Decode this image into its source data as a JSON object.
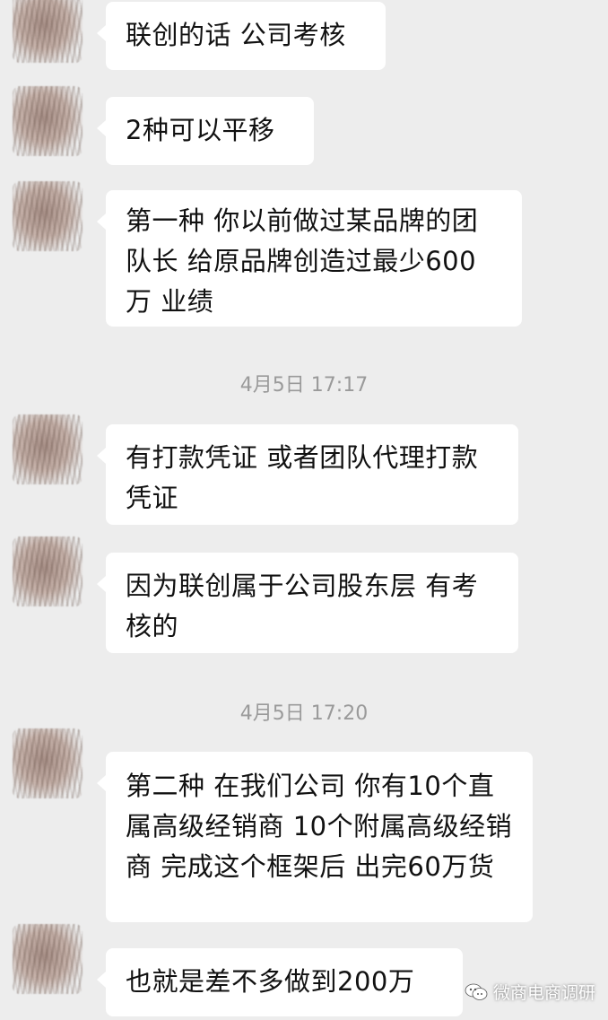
{
  "messages": [
    {
      "text": "联创的话 公司考核"
    },
    {
      "text": "2种可以平移"
    },
    {
      "text": "第一种 你以前做过某品牌的团队长  给原品牌创造过最少600万 业绩"
    },
    {
      "text": "有打款凭证 或者团队代理打款凭证"
    },
    {
      "text": "因为联创属于公司股东层 有考核的"
    },
    {
      "text": "第二种 在我们公司 你有10个直属高级经销商 10个附属高级经销商 完成这个框架后 出完60万货"
    },
    {
      "text": "也就是差不多做到200万"
    }
  ],
  "timestamps": [
    {
      "text": "4月5日 17:17"
    },
    {
      "text": "4月5日 17:20"
    }
  ],
  "watermark": {
    "text": "微商电商调研",
    "icon": "wechat-icon"
  },
  "colors": {
    "background": "#ededed",
    "bubble": "#ffffff",
    "timestamp": "#9a9a9a"
  }
}
